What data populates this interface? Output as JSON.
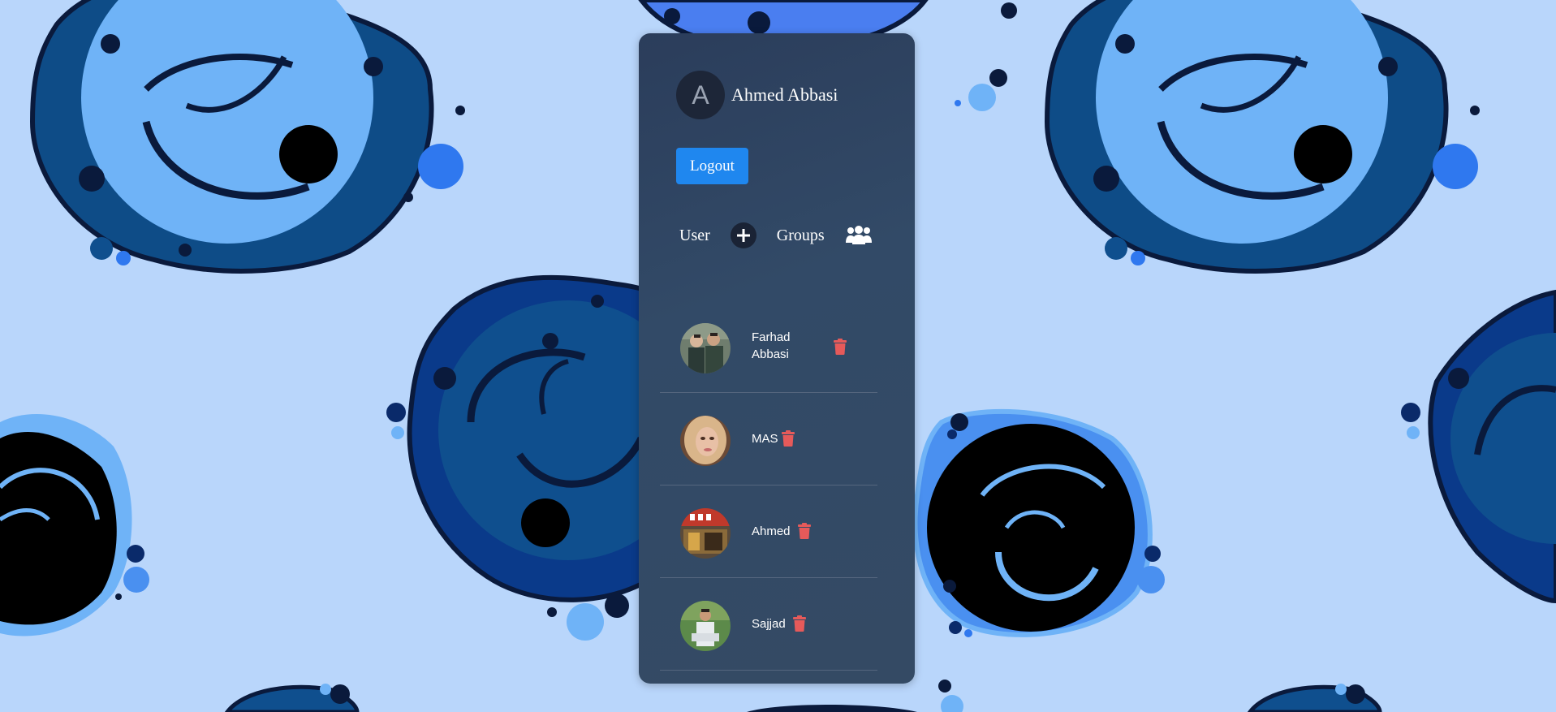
{
  "profile": {
    "avatar_letter": "A",
    "name": "Ahmed Abbasi"
  },
  "actions": {
    "logout_label": "Logout"
  },
  "nav": {
    "user_label": "User",
    "groups_label": "Groups",
    "add_icon": "plus-icon",
    "groups_icon": "users-group-icon"
  },
  "users": [
    {
      "first": "Farhad",
      "last": "Abbasi",
      "avatar": "photo-two-men"
    },
    {
      "first": "MAS",
      "last": "",
      "avatar": "photo-woman"
    },
    {
      "first": "Ahmed",
      "last": "",
      "avatar": "photo-kfc-storefront"
    },
    {
      "first": "Sajjad",
      "last": "",
      "avatar": "photo-man-outdoors"
    }
  ],
  "colors": {
    "background": "#b9d6fb",
    "panel": "#344a64",
    "logout": "#1f87ef",
    "trash": "#e65a5a"
  }
}
